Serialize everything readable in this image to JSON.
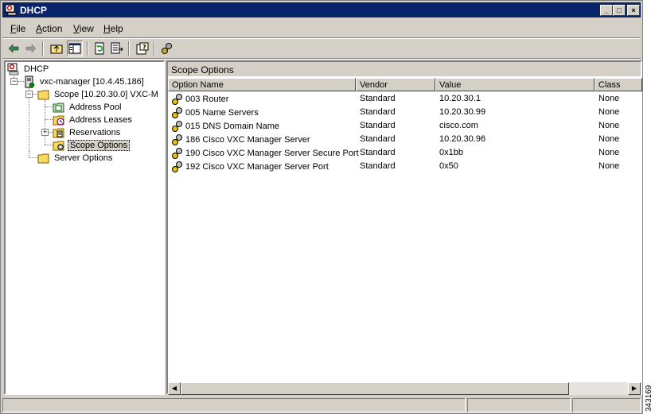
{
  "window": {
    "title": "DHCP",
    "controls": {
      "minimize": "_",
      "maximize": "□",
      "close": "×"
    }
  },
  "menu": {
    "items": [
      {
        "key": "F",
        "rest": "ile"
      },
      {
        "key": "A",
        "rest": "ction"
      },
      {
        "key": "V",
        "rest": "iew"
      },
      {
        "key": "H",
        "rest": "elp"
      }
    ]
  },
  "toolbar": {
    "icons": [
      "back-arrow-icon",
      "forward-arrow-icon",
      "up-folder-icon",
      "show-hide-tree-icon",
      "refresh-icon",
      "export-list-icon",
      "help-icon",
      "configure-options-icon"
    ]
  },
  "tree": {
    "root": "DHCP",
    "server": "vxc-manager [10.4.45.186]",
    "scope": "Scope [10.20.30.0] VXC-M",
    "address_pool": "Address Pool",
    "address_leases": "Address Leases",
    "reservations": "Reservations",
    "scope_options": "Scope Options",
    "server_options": "Server Options",
    "expand_minus": "−",
    "expand_plus": "+"
  },
  "details": {
    "header": "Scope Options",
    "columns": [
      "Option Name",
      "Vendor",
      "Value",
      "Class"
    ],
    "rows": [
      {
        "name": "003 Router",
        "vendor": "Standard",
        "value": "10.20.30.1",
        "class": "None"
      },
      {
        "name": "005 Name Servers",
        "vendor": "Standard",
        "value": "10.20.30.99",
        "class": "None"
      },
      {
        "name": "015 DNS Domain Name",
        "vendor": "Standard",
        "value": "cisco.com",
        "class": "None"
      },
      {
        "name": "186 Cisco VXC Manager Server",
        "vendor": "Standard",
        "value": "10.20.30.96",
        "class": "None"
      },
      {
        "name": "190 Cisco VXC Manager Server Secure Port",
        "vendor": "Standard",
        "value": "0x1bb",
        "class": "None"
      },
      {
        "name": "192 Cisco VXC Manager Server Port",
        "vendor": "Standard",
        "value": "0x50",
        "class": "None"
      }
    ]
  },
  "scrollbar": {
    "left_arrow": "◀",
    "right_arrow": "▶"
  },
  "figure_id": "343169"
}
